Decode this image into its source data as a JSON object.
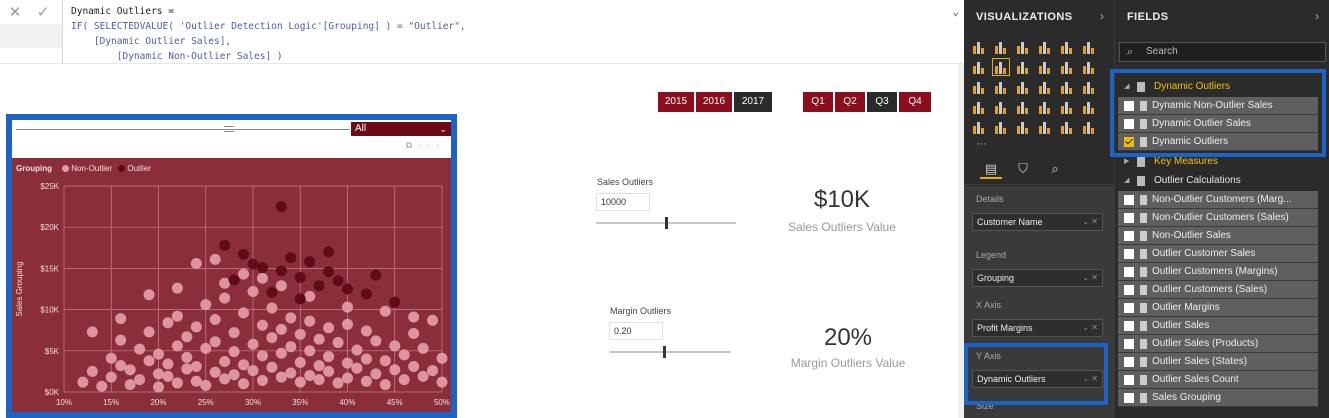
{
  "formula": {
    "lines": [
      "Dynamic Outliers =",
      "IF( SELECTEDVALUE( 'Outlier Detection Logic'[Grouping] ) = \"Outlier\",",
      "    [Dynamic Outlier Sales],",
      "        [Dynamic Non-Outlier Sales] )"
    ],
    "cancel_icon": "close-icon",
    "commit_icon": "check-icon",
    "expand_icon": "chevron-down-icon"
  },
  "chart_data": {
    "type": "scatter",
    "dropdown_value": "All",
    "legend": {
      "title": "Grouping",
      "placement": "top-left",
      "items": [
        "Non-Outlier",
        "Outlier"
      ]
    },
    "ylabel": "Sales Grouping",
    "xlabel": "",
    "xlim": [
      0.1,
      0.5
    ],
    "ylim": [
      0,
      25000
    ],
    "x_ticks": [
      "10%",
      "15%",
      "20%",
      "25%",
      "30%",
      "35%",
      "40%",
      "45%",
      "50%"
    ],
    "y_ticks": [
      "$0K",
      "$5K",
      "$10K",
      "$15K",
      "$20K",
      "$25K"
    ],
    "grid": true,
    "colors": {
      "background": "#8a2e3c",
      "non_outlier": "#e19aa7",
      "outlier": "#5c0b18",
      "grid": "#c97f8b"
    },
    "series": [
      {
        "name": "Non-Outlier",
        "points": [
          [
            0.12,
            1200
          ],
          [
            0.13,
            2500
          ],
          [
            0.14,
            700
          ],
          [
            0.15,
            4100
          ],
          [
            0.15,
            1800
          ],
          [
            0.16,
            3200
          ],
          [
            0.16,
            6300
          ],
          [
            0.17,
            900
          ],
          [
            0.17,
            2700
          ],
          [
            0.18,
            5200
          ],
          [
            0.18,
            1500
          ],
          [
            0.19,
            3800
          ],
          [
            0.19,
            7300
          ],
          [
            0.2,
            600
          ],
          [
            0.2,
            2200
          ],
          [
            0.2,
            4600
          ],
          [
            0.21,
            8400
          ],
          [
            0.21,
            1900
          ],
          [
            0.21,
            3400
          ],
          [
            0.22,
            5600
          ],
          [
            0.22,
            1100
          ],
          [
            0.22,
            9200
          ],
          [
            0.23,
            2800
          ],
          [
            0.23,
            6700
          ],
          [
            0.23,
            4200
          ],
          [
            0.24,
            1300
          ],
          [
            0.24,
            7900
          ],
          [
            0.24,
            3100
          ],
          [
            0.25,
            5300
          ],
          [
            0.25,
            10600
          ],
          [
            0.25,
            800
          ],
          [
            0.26,
            2400
          ],
          [
            0.26,
            6100
          ],
          [
            0.26,
            8800
          ],
          [
            0.27,
            3700
          ],
          [
            0.27,
            1600
          ],
          [
            0.27,
            11400
          ],
          [
            0.28,
            4900
          ],
          [
            0.28,
            2100
          ],
          [
            0.28,
            7200
          ],
          [
            0.29,
            9600
          ],
          [
            0.29,
            3300
          ],
          [
            0.29,
            1000
          ],
          [
            0.3,
            5800
          ],
          [
            0.3,
            12200
          ],
          [
            0.3,
            2600
          ],
          [
            0.31,
            8100
          ],
          [
            0.31,
            4400
          ],
          [
            0.31,
            1400
          ],
          [
            0.32,
            6600
          ],
          [
            0.32,
            10200
          ],
          [
            0.32,
            3000
          ],
          [
            0.33,
            7600
          ],
          [
            0.33,
            1800
          ],
          [
            0.33,
            4700
          ],
          [
            0.34,
            9000
          ],
          [
            0.34,
            2300
          ],
          [
            0.34,
            5500
          ],
          [
            0.35,
            1200
          ],
          [
            0.35,
            7000
          ],
          [
            0.35,
            3600
          ],
          [
            0.36,
            8600
          ],
          [
            0.36,
            2000
          ],
          [
            0.36,
            5000
          ],
          [
            0.37,
            1500
          ],
          [
            0.37,
            6400
          ],
          [
            0.37,
            3200
          ],
          [
            0.38,
            7800
          ],
          [
            0.38,
            2500
          ],
          [
            0.38,
            4300
          ],
          [
            0.39,
            1100
          ],
          [
            0.39,
            6000
          ],
          [
            0.4,
            3500
          ],
          [
            0.4,
            8200
          ],
          [
            0.4,
            1700
          ],
          [
            0.41,
            5100
          ],
          [
            0.41,
            2900
          ],
          [
            0.42,
            7400
          ],
          [
            0.42,
            1300
          ],
          [
            0.42,
            4000
          ],
          [
            0.43,
            6200
          ],
          [
            0.43,
            2200
          ],
          [
            0.44,
            3800
          ],
          [
            0.44,
            900
          ],
          [
            0.45,
            5600
          ],
          [
            0.45,
            2700
          ],
          [
            0.46,
            1500
          ],
          [
            0.46,
            4500
          ],
          [
            0.47,
            3100
          ],
          [
            0.47,
            7100
          ],
          [
            0.48,
            1900
          ],
          [
            0.48,
            5300
          ],
          [
            0.49,
            2600
          ],
          [
            0.49,
            8700
          ],
          [
            0.5,
            1200
          ],
          [
            0.5,
            4100
          ],
          [
            0.26,
            16100
          ],
          [
            0.29,
            14300
          ],
          [
            0.24,
            15600
          ],
          [
            0.27,
            13200
          ],
          [
            0.31,
            13800
          ],
          [
            0.22,
            12600
          ],
          [
            0.19,
            11800
          ],
          [
            0.33,
            12900
          ],
          [
            0.36,
            11600
          ],
          [
            0.4,
            10300
          ],
          [
            0.44,
            9800
          ],
          [
            0.47,
            9100
          ],
          [
            0.16,
            8900
          ],
          [
            0.13,
            7300
          ]
        ]
      },
      {
        "name": "Outlier",
        "points": [
          [
            0.33,
            22500
          ],
          [
            0.27,
            17800
          ],
          [
            0.29,
            16700
          ],
          [
            0.3,
            15500
          ],
          [
            0.31,
            15100
          ],
          [
            0.33,
            14700
          ],
          [
            0.34,
            16300
          ],
          [
            0.35,
            13900
          ],
          [
            0.36,
            15800
          ],
          [
            0.37,
            12900
          ],
          [
            0.38,
            14600
          ],
          [
            0.39,
            13500
          ],
          [
            0.4,
            12500
          ],
          [
            0.42,
            11900
          ],
          [
            0.43,
            14200
          ],
          [
            0.45,
            10900
          ],
          [
            0.28,
            13600
          ],
          [
            0.32,
            12100
          ],
          [
            0.35,
            11300
          ],
          [
            0.38,
            17000
          ]
        ]
      }
    ]
  },
  "slicers": {
    "years": [
      {
        "label": "2015",
        "selected": true
      },
      {
        "label": "2016",
        "selected": true
      },
      {
        "label": "2017",
        "selected": false
      }
    ],
    "quarters": [
      {
        "label": "Q1",
        "selected": true
      },
      {
        "label": "Q2",
        "selected": true
      },
      {
        "label": "Q3",
        "selected": false
      },
      {
        "label": "Q4",
        "selected": true
      }
    ]
  },
  "sales_param": {
    "label": "Sales Outliers",
    "value": "10000",
    "fraction": 0.5
  },
  "margin_param": {
    "label": "Margin Outliers",
    "value": "0.20",
    "fraction": 0.45
  },
  "cards": [
    {
      "value": "$10K",
      "label": "Sales Outliers Value"
    },
    {
      "value": "20%",
      "label": "Margin Outliers Value"
    }
  ],
  "viz_pane": {
    "title": "VISUALIZATIONS",
    "chevron_icon": "chevron-right-icon",
    "more": "···",
    "tabs": [
      "fields-tab-icon",
      "format-paint-icon",
      "analytics-icon"
    ],
    "wells": [
      {
        "label": "Details",
        "field": "Customer Name"
      },
      {
        "label": "Legend",
        "field": "Grouping"
      },
      {
        "label": "X Axis",
        "field": "Profit Margins"
      },
      {
        "label": "Y Axis",
        "field": "Dynamic Outliers"
      },
      {
        "label": "Size",
        "field": ""
      }
    ]
  },
  "fields_pane": {
    "title": "FIELDS",
    "chevron_icon": "chevron-right-icon",
    "search_placeholder": "Search",
    "tables": [
      {
        "name": "Dynamic Outliers",
        "expanded": true,
        "accent": true,
        "fields": [
          {
            "name": "Dynamic Non-Outlier Sales",
            "checked": false
          },
          {
            "name": "Dynamic Outlier Sales",
            "checked": false
          },
          {
            "name": "Dynamic Outliers",
            "checked": true
          }
        ]
      },
      {
        "name": "Key Measures",
        "expanded": false,
        "accent": true,
        "fields": []
      },
      {
        "name": "Outlier Calculations",
        "expanded": true,
        "accent": false,
        "fields": [
          {
            "name": "Non-Outlier Customers (Marg...",
            "checked": false
          },
          {
            "name": "Non-Outlier Customers (Sales)",
            "checked": false
          },
          {
            "name": "Non-Outlier Sales",
            "checked": false
          },
          {
            "name": "Outlier Customer Sales",
            "checked": false
          },
          {
            "name": "Outlier Customers (Margins)",
            "checked": false
          },
          {
            "name": "Outlier Customers (Sales)",
            "checked": false
          },
          {
            "name": "Outlier Margins",
            "checked": false
          },
          {
            "name": "Outlier Sales",
            "checked": false
          },
          {
            "name": "Outlier Sales (Products)",
            "checked": false
          },
          {
            "name": "Outlier Sales (States)",
            "checked": false
          },
          {
            "name": "Outlier Sales Count",
            "checked": false
          },
          {
            "name": "Sales Grouping",
            "checked": false
          }
        ]
      }
    ]
  }
}
